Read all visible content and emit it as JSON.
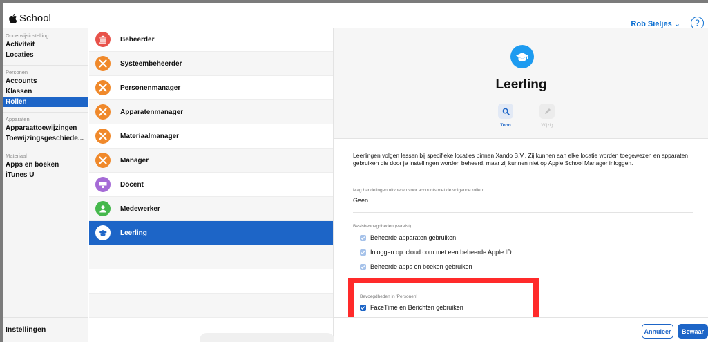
{
  "app": {
    "title": "School"
  },
  "header": {
    "user_label": "Rob Sieljes ⌄",
    "help_glyph": "?"
  },
  "nav": {
    "sections": [
      {
        "title": "Onderwijsinstelling",
        "items": [
          "Activiteit",
          "Locaties"
        ]
      },
      {
        "title": "Personen",
        "items": [
          "Accounts",
          "Klassen",
          "Rollen"
        ]
      },
      {
        "title": "Apparaten",
        "items": [
          "Apparaattoewijzingen",
          "Toewijzingsgeschiede..."
        ]
      },
      {
        "title": "Materiaal",
        "items": [
          "Apps en boeken",
          "iTunes U"
        ]
      }
    ],
    "active_item": "Rollen",
    "footer_item": "Instellingen"
  },
  "roles": [
    {
      "label": "Beheerder",
      "icon": "building-icon",
      "color": "#e8524a"
    },
    {
      "label": "Systeembeheerder",
      "icon": "tools-icon",
      "color": "#f0892b"
    },
    {
      "label": "Personenmanager",
      "icon": "tools-icon",
      "color": "#f0892b"
    },
    {
      "label": "Apparatenmanager",
      "icon": "tools-icon",
      "color": "#f0892b"
    },
    {
      "label": "Materiaalmanager",
      "icon": "tools-icon",
      "color": "#f0892b"
    },
    {
      "label": "Manager",
      "icon": "tools-icon",
      "color": "#f0892b"
    },
    {
      "label": "Docent",
      "icon": "teacher-icon",
      "color": "#a56bd6"
    },
    {
      "label": "Medewerker",
      "icon": "person-icon",
      "color": "#45b84c"
    },
    {
      "label": "Leerling",
      "icon": "graduation-cap-icon",
      "color": "#1d9bf0"
    }
  ],
  "selected_role": "Leerling",
  "detail": {
    "title": "Leerling",
    "view_label": "Toon",
    "edit_label": "Wijzig",
    "description": "Leerlingen volgen lessen bij specifieke locaties binnen Xando B.V.. Zij kunnen aan elke locatie worden toegewezen en apparaten gebruiken die door je instellingen worden beheerd, maar zij kunnen niet op Apple School Manager inloggen.",
    "manage_roles_label": "Mag handelingen uitvoeren voor accounts met de volgende rollen:",
    "manage_roles_value": "Geen",
    "basic_label": "Basisbevoegdheden (vereist)",
    "basic_permissions": [
      "Beheerde apparaten gebruiken",
      "Inloggen op icloud.com met een beheerde Apple ID",
      "Beheerde apps en boeken gebruiken"
    ],
    "people_label": "Bevoegdheden in 'Personen'",
    "people_permissions": [
      "FaceTime en Berichten gebruiken"
    ]
  },
  "footer": {
    "cancel_label": "Annuleer",
    "save_label": "Bewaar"
  },
  "colors": {
    "accent": "#1d65c7",
    "highlight": "#ff2a2a"
  }
}
